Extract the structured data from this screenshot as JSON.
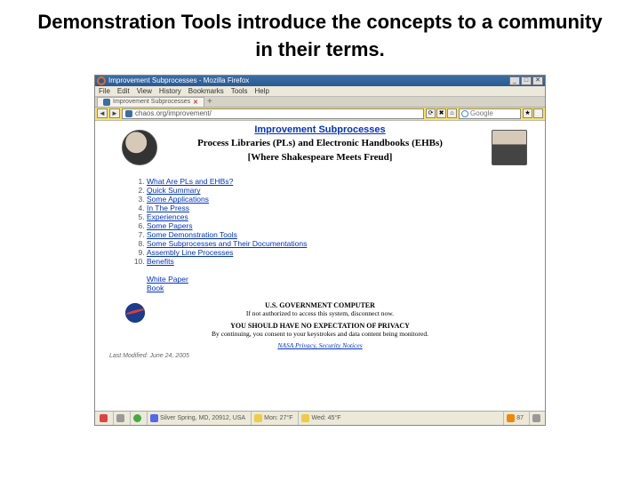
{
  "slide_title": "Demonstration Tools introduce the concepts to a community in their terms.",
  "window": {
    "title": "Improvement Subprocesses - Mozilla Firefox",
    "min": "_",
    "max": "□",
    "close": "✕"
  },
  "menu": [
    "File",
    "Edit",
    "View",
    "History",
    "Bookmarks",
    "Tools",
    "Help"
  ],
  "tab": {
    "label": "Improvement Subprocesses",
    "close": "✕"
  },
  "nav": {
    "back": "◄",
    "fwd": "►",
    "url": "chaos.org/improvement/",
    "reload": "⟳",
    "stop": "✖",
    "search_ph": "Google",
    "home": "⌂"
  },
  "page": {
    "title_link": "Improvement Subprocesses",
    "subtitle1": "Process Libraries (PLs) and Electronic Handbooks (EHBs)",
    "subtitle2": "[Where Shakespeare Meets Freud]"
  },
  "toc": [
    "What Are PLs and EHBs?",
    "Quick Summary",
    "Some Applications",
    "In The Press",
    "Experiences",
    "Some Papers",
    "Some Demonstration Tools",
    "Some Subprocesses and Their Documentations",
    "Assembly Line Processes",
    "Benefits"
  ],
  "supp": [
    "White Paper",
    "Book"
  ],
  "notice": {
    "h1": "U.S. GOVERNMENT COMPUTER",
    "l1": "If not authorized to access this system, disconnect now.",
    "h2": "YOU SHOULD HAVE NO EXPECTATION OF PRIVACY",
    "l2": "By continuing, you consent to your keystrokes and data content being monitored.",
    "priv": "NASA Privacy, Security Notices"
  },
  "modline": "Last Modified: June 24, 2005",
  "status": {
    "s1": "Silver Spring, MD, 20912, USA",
    "s2": "Mon: 27°F",
    "s3": "Wed: 45°F",
    "s4": "87"
  }
}
